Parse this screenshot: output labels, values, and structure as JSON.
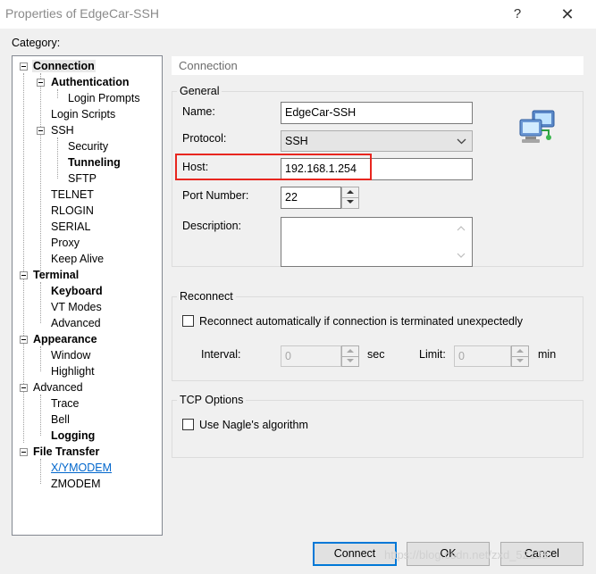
{
  "window": {
    "title": "Properties of EdgeCar-SSH",
    "help": "?",
    "close": "✕"
  },
  "category_label": "Category:",
  "tree": [
    {
      "label": "Connection",
      "bold": true,
      "selected": true,
      "expander": true
    },
    {
      "label": "Authentication",
      "bold": true,
      "expander": true
    },
    {
      "label": "Login Prompts"
    },
    {
      "label": "Login Scripts"
    },
    {
      "label": "SSH",
      "expander": true
    },
    {
      "label": "Security"
    },
    {
      "label": "Tunneling",
      "bold": true
    },
    {
      "label": "SFTP"
    },
    {
      "label": "TELNET"
    },
    {
      "label": "RLOGIN"
    },
    {
      "label": "SERIAL"
    },
    {
      "label": "Proxy"
    },
    {
      "label": "Keep Alive"
    },
    {
      "label": "Terminal",
      "bold": true,
      "expander": true
    },
    {
      "label": "Keyboard",
      "bold": true
    },
    {
      "label": "VT Modes"
    },
    {
      "label": "Advanced"
    },
    {
      "label": "Appearance",
      "bold": true,
      "expander": true
    },
    {
      "label": "Window"
    },
    {
      "label": "Highlight"
    },
    {
      "label": "Advanced",
      "expander": true
    },
    {
      "label": "Trace"
    },
    {
      "label": "Bell"
    },
    {
      "label": "Logging",
      "bold": true
    },
    {
      "label": "File Transfer",
      "bold": true,
      "expander": true
    },
    {
      "label": "X/YMODEM",
      "link": true
    },
    {
      "label": "ZMODEM"
    }
  ],
  "section_title": "Connection",
  "general": {
    "title": "General",
    "name_label": "Name:",
    "name_value": "EdgeCar-SSH",
    "protocol_label": "Protocol:",
    "protocol_value": "SSH",
    "host_label": "Host:",
    "host_value": "192.168.1.254",
    "port_label": "Port Number:",
    "port_value": "22",
    "description_label": "Description:",
    "description_value": ""
  },
  "reconnect": {
    "title": "Reconnect",
    "auto_label": "Reconnect automatically if connection is terminated unexpectedly",
    "auto_checked": false,
    "interval_label": "Interval:",
    "interval_value": "0",
    "interval_unit": "sec",
    "limit_label": "Limit:",
    "limit_value": "0",
    "limit_unit": "min"
  },
  "tcp": {
    "title": "TCP Options",
    "nagle_label": "Use Nagle's algorithm",
    "nagle_checked": false
  },
  "buttons": {
    "connect": "Connect",
    "ok": "OK",
    "cancel": "Cancel"
  },
  "watermark": "https://blog.csdn.net/zxd_52138",
  "colors": {
    "highlight_box": "#e8261f",
    "accent": "#0078d7",
    "link": "#0066cc"
  }
}
